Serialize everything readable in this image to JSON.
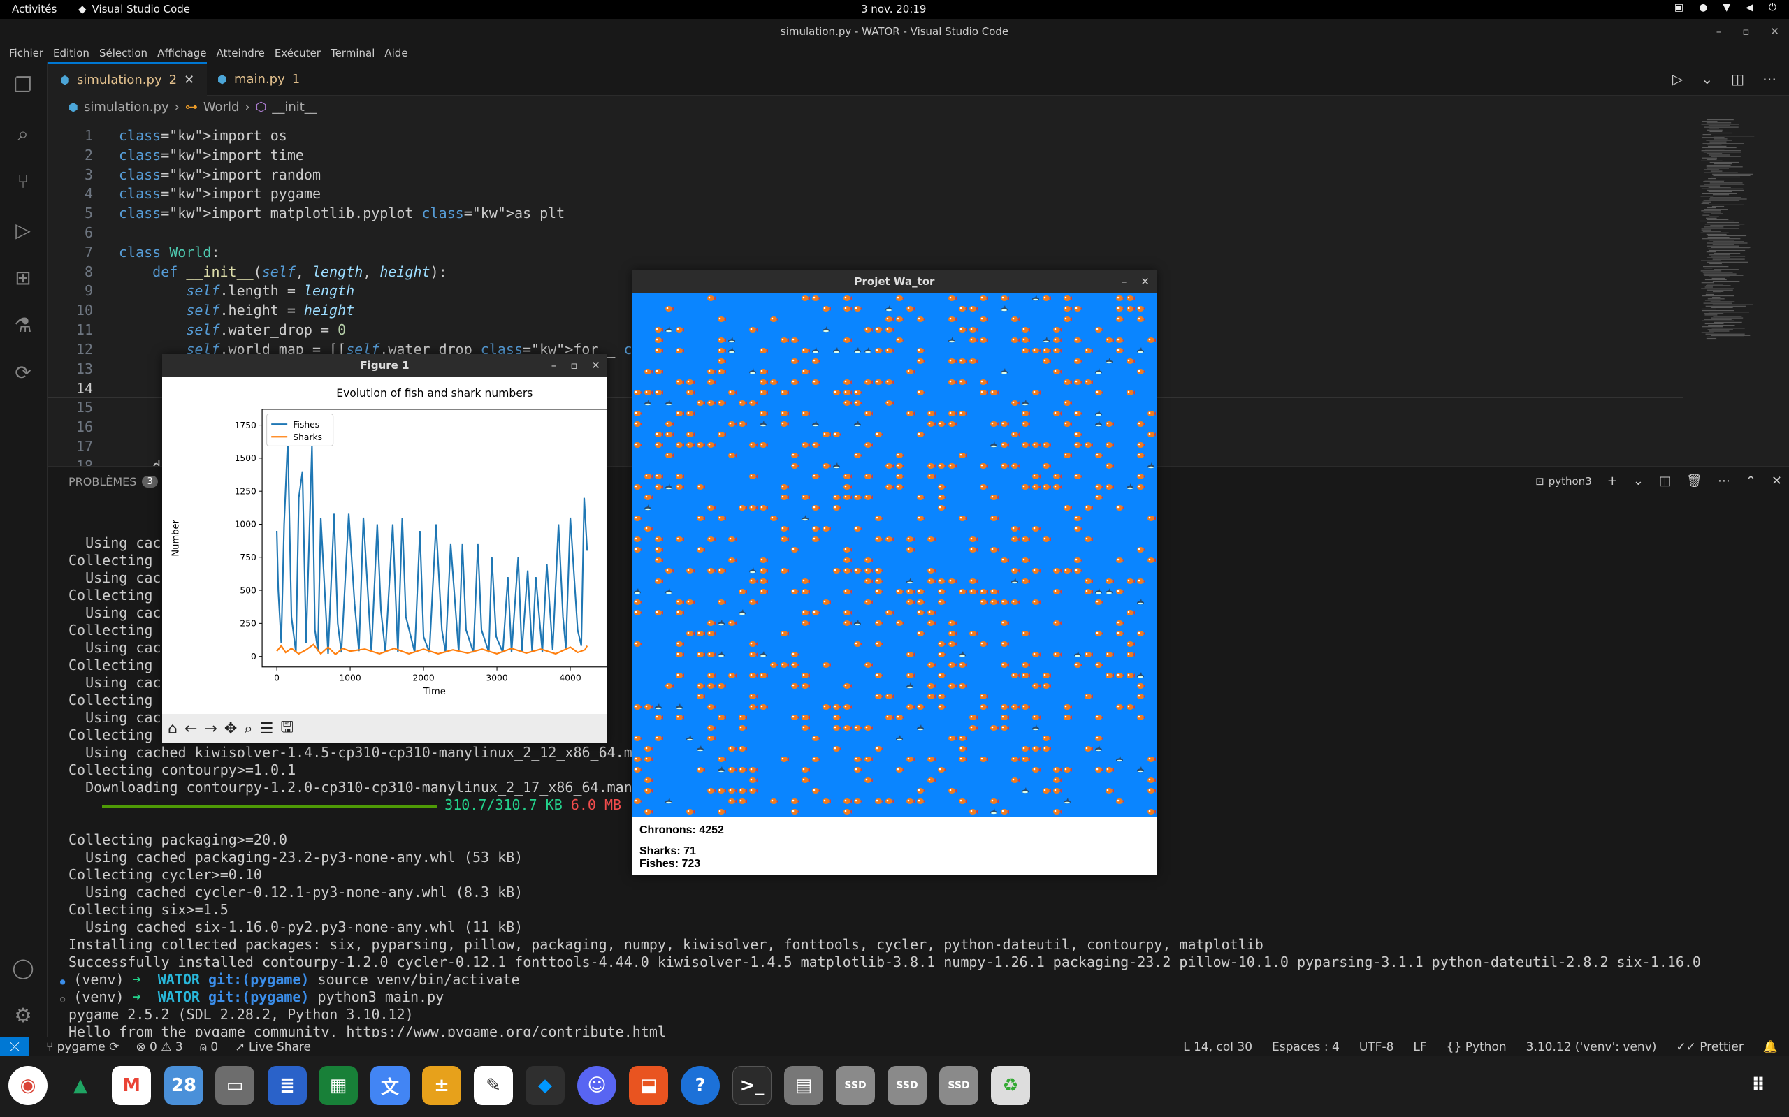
{
  "system": {
    "activities": "Activités",
    "app_name": "Visual Studio Code",
    "clock": "3 nov.  20:19"
  },
  "window": {
    "title": "simulation.py - WATOR - Visual Studio Code"
  },
  "menu": [
    "Fichier",
    "Edition",
    "Sélection",
    "Affichage",
    "Atteindre",
    "Exécuter",
    "Terminal",
    "Aide"
  ],
  "tabs": [
    {
      "name": "simulation.py",
      "badge": "2",
      "active": true
    },
    {
      "name": "main.py",
      "badge": "1",
      "active": false
    }
  ],
  "breadcrumb": [
    "simulation.py",
    "World",
    "__init__"
  ],
  "editor": {
    "lines": [
      {
        "n": "1",
        "code": "import os"
      },
      {
        "n": "2",
        "code": "import time"
      },
      {
        "n": "3",
        "code": "import random"
      },
      {
        "n": "4",
        "code": "import pygame"
      },
      {
        "n": "5",
        "code": "import matplotlib.pyplot as plt"
      },
      {
        "n": "6",
        "code": ""
      },
      {
        "n": "7",
        "code": "class World:"
      },
      {
        "n": "8",
        "code": "    def __init__(self, length, height):"
      },
      {
        "n": "9",
        "code": "        self.length = length"
      },
      {
        "n": "10",
        "code": "        self.height = height"
      },
      {
        "n": "11",
        "code": "        self.water_drop = 0"
      },
      {
        "n": "12",
        "code": "        self.world_map = [[self.water_drop for _ in range(len"
      },
      {
        "n": "13",
        "code": ""
      },
      {
        "n": "14",
        "code": ""
      },
      {
        "n": "15",
        "code": "                                                  th"
      },
      {
        "n": "16",
        "code": ""
      },
      {
        "n": "17",
        "code": ""
      },
      {
        "n": "18",
        "code": "    d"
      }
    ]
  },
  "panel": {
    "tab_label": "PROBLÈMES",
    "tab_count": "3",
    "terminal_name": "python3"
  },
  "terminal": {
    "lines": [
      "  Using cac",
      "Collecting ",
      "  Using cac",
      "Collecting ",
      "  Using cac",
      "Collecting ",
      "  Using cac",
      "Collecting ",
      "  Using cac",
      "Collecting ",
      "  Using cac",
      "Collecting ",
      "  Using cached kiwisolver-1.4.5-cp310-cp310-manylinux_2_12_x86_64.ma",
      "Collecting contourpy>=1.0.1",
      "  Downloading contourpy-1.2.0-cp310-cp310-manylinux_2_17_x86_64.man"
    ],
    "progress": "310.7/310.7 KB",
    "speed": "6.0 MB",
    "progress_fraction": 1.0,
    "lines2": [
      "",
      "Collecting packaging>=20.0",
      "  Using cached packaging-23.2-py3-none-any.whl (53 kB)",
      "Collecting cycler>=0.10",
      "  Using cached cycler-0.12.1-py3-none-any.whl (8.3 kB)",
      "Collecting six>=1.5",
      "  Using cached six-1.16.0-py2.py3-none-any.whl (11 kB)",
      "Installing collected packages: six, pyparsing, pillow, packaging, numpy, kiwisolver, fonttools, cycler, python-dateutil, contourpy, matplotlib",
      "Successfully installed contourpy-1.2.0 cycler-0.12.1 fonttools-4.44.0 kiwisolver-1.4.5 matplotlib-3.8.1 numpy-1.26.1 packaging-23.2 pillow-10.1.0 pyparsing-3.1.1 python-dateutil-2.8.2 six-1.16.0"
    ],
    "prompt1": {
      "venv": "(venv)",
      "arrow": "➜",
      "dir": "WATOR",
      "git": "git:(pygame)",
      "cmd": "source venv/bin/activate"
    },
    "prompt2": {
      "venv": "(venv)",
      "arrow": "➜",
      "dir": "WATOR",
      "git": "git:(pygame)",
      "cmd": "python3 main.py"
    },
    "out1": "pygame 2.5.2 (SDL 2.28.2, Python 3.10.12)",
    "out2": "Hello from the pygame community. https://www.pygame.org/contribute.html",
    "partial_right": [
      ".m",
      "hl",
      "B)",
      "",
      ".m",
      "nyl"
    ]
  },
  "status": {
    "branch": "pygame",
    "errors": "0",
    "warnings": "3",
    "ports": "0",
    "live_share": "Live Share",
    "position": "L 14, col 30",
    "spaces": "Espaces : 4",
    "encoding": "UTF-8",
    "eol": "LF",
    "language": "Python",
    "interpreter": "3.10.12 ('venv': venv)",
    "formatter": "Prettier"
  },
  "pygame_window": {
    "title": "Projet Wa_tor",
    "chronons": "Chronons: 4252",
    "sharks": "Sharks: 71",
    "fishes": "Fishes: 723"
  },
  "figure_window": {
    "title": "Figure 1"
  },
  "chart_data": {
    "type": "line",
    "title": "Evolution of fish and shark numbers",
    "xlabel": "Time",
    "ylabel": "Number",
    "xlim": [
      -200,
      4500
    ],
    "ylim": [
      -80,
      1870
    ],
    "xticks": [
      "0",
      "1000",
      "2000",
      "3000",
      "4000"
    ],
    "yticks": [
      "0",
      "250",
      "500",
      "750",
      "1000",
      "1250",
      "1500",
      "1750"
    ],
    "legend_position": "top-left",
    "series": [
      {
        "name": "Fishes",
        "color": "#1f77b4",
        "x": [
          0,
          20,
          60,
          100,
          150,
          200,
          260,
          300,
          350,
          400,
          480,
          520,
          560,
          600,
          700,
          780,
          830,
          880,
          980,
          1060,
          1120,
          1180,
          1290,
          1370,
          1420,
          1480,
          1580,
          1650,
          1710,
          1760,
          1880,
          1950,
          2000,
          2080,
          2170,
          2250,
          2300,
          2370,
          2480,
          2530,
          2580,
          2680,
          2740,
          2790,
          2890,
          2930,
          2990,
          3080,
          3150,
          3200,
          3290,
          3340,
          3420,
          3480,
          3530,
          3620,
          3680,
          3760,
          3840,
          3900,
          3940,
          4000,
          4100,
          4150,
          4190,
          4230
        ],
        "y": [
          950,
          500,
          100,
          1000,
          1650,
          300,
          30,
          1200,
          1400,
          100,
          1600,
          200,
          40,
          1050,
          20,
          1080,
          250,
          30,
          1080,
          400,
          40,
          1050,
          30,
          1000,
          350,
          30,
          1000,
          30,
          1050,
          300,
          30,
          950,
          150,
          30,
          1000,
          200,
          30,
          850,
          30,
          850,
          200,
          30,
          850,
          200,
          30,
          750,
          150,
          30,
          600,
          30,
          750,
          30,
          650,
          30,
          600,
          30,
          700,
          50,
          1000,
          300,
          60,
          1050,
          200,
          80,
          1200,
          800
        ]
      },
      {
        "name": "Sharks",
        "color": "#ff7f0e",
        "x": [
          0,
          60,
          120,
          200,
          300,
          400,
          500,
          600,
          700,
          800,
          900,
          1000,
          1200,
          1400,
          1600,
          1800,
          2000,
          2200,
          2400,
          2600,
          2800,
          3000,
          3200,
          3400,
          3600,
          3800,
          4000,
          4100,
          4200,
          4230
        ],
        "y": [
          40,
          80,
          30,
          60,
          20,
          50,
          90,
          20,
          70,
          15,
          60,
          40,
          55,
          20,
          60,
          20,
          55,
          20,
          50,
          25,
          55,
          20,
          60,
          25,
          55,
          20,
          70,
          30,
          50,
          80
        ]
      }
    ]
  }
}
